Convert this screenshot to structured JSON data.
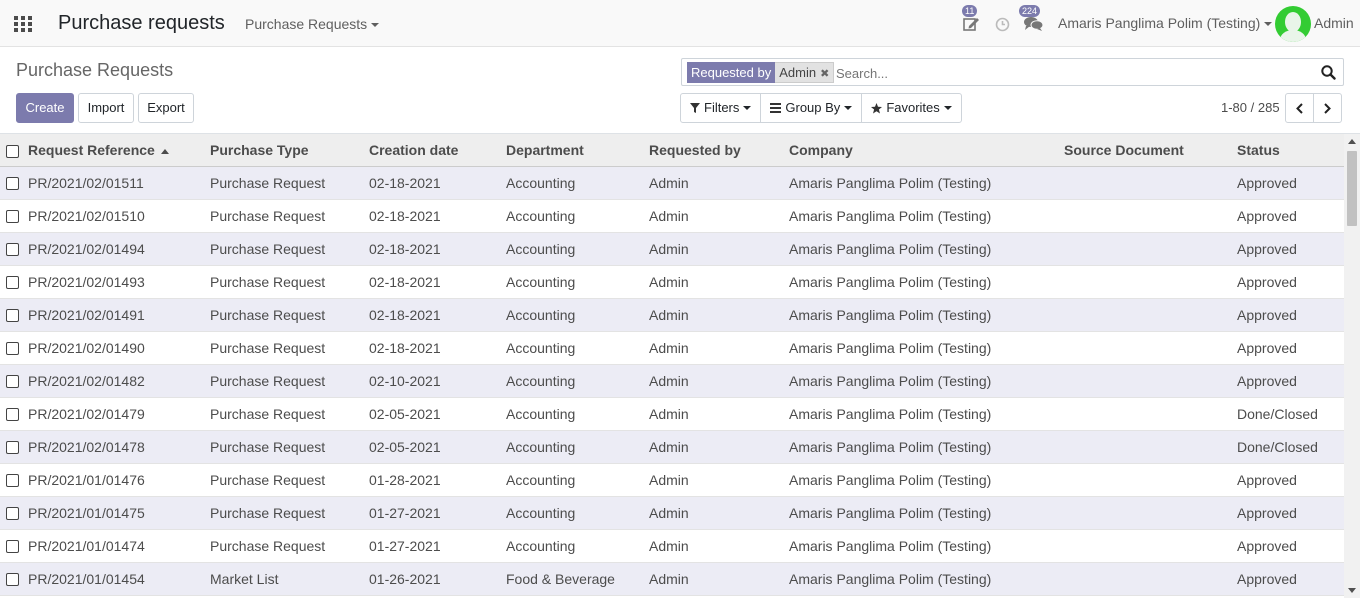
{
  "navbar": {
    "app_title": "Purchase requests",
    "menu": "Purchase Requests",
    "activity_count": "11",
    "messages_count": "224",
    "company": "Amaris Panglima Polim (Testing)",
    "user": "Admin"
  },
  "control_panel": {
    "breadcrumb": "Purchase Requests",
    "create_label": "Create",
    "import_label": "Import",
    "export_label": "Export",
    "search": {
      "facet_label": "Requested by",
      "facet_value": "Admin",
      "placeholder": "Search..."
    },
    "filters_label": "Filters",
    "groupby_label": "Group By",
    "favorites_label": "Favorites",
    "pager": "1-80 / 285"
  },
  "table": {
    "columns": [
      "Request Reference",
      "Purchase Type",
      "Creation date",
      "Department",
      "Requested by",
      "Company",
      "Source Document",
      "Status"
    ],
    "rows": [
      [
        "PR/2021/02/01511",
        "Purchase Request",
        "02-18-2021",
        "Accounting",
        "Admin",
        "Amaris Panglima Polim (Testing)",
        "",
        "Approved"
      ],
      [
        "PR/2021/02/01510",
        "Purchase Request",
        "02-18-2021",
        "Accounting",
        "Admin",
        "Amaris Panglima Polim (Testing)",
        "",
        "Approved"
      ],
      [
        "PR/2021/02/01494",
        "Purchase Request",
        "02-18-2021",
        "Accounting",
        "Admin",
        "Amaris Panglima Polim (Testing)",
        "",
        "Approved"
      ],
      [
        "PR/2021/02/01493",
        "Purchase Request",
        "02-18-2021",
        "Accounting",
        "Admin",
        "Amaris Panglima Polim (Testing)",
        "",
        "Approved"
      ],
      [
        "PR/2021/02/01491",
        "Purchase Request",
        "02-18-2021",
        "Accounting",
        "Admin",
        "Amaris Panglima Polim (Testing)",
        "",
        "Approved"
      ],
      [
        "PR/2021/02/01490",
        "Purchase Request",
        "02-18-2021",
        "Accounting",
        "Admin",
        "Amaris Panglima Polim (Testing)",
        "",
        "Approved"
      ],
      [
        "PR/2021/02/01482",
        "Purchase Request",
        "02-10-2021",
        "Accounting",
        "Admin",
        "Amaris Panglima Polim (Testing)",
        "",
        "Approved"
      ],
      [
        "PR/2021/02/01479",
        "Purchase Request",
        "02-05-2021",
        "Accounting",
        "Admin",
        "Amaris Panglima Polim (Testing)",
        "",
        "Done/Closed"
      ],
      [
        "PR/2021/02/01478",
        "Purchase Request",
        "02-05-2021",
        "Accounting",
        "Admin",
        "Amaris Panglima Polim (Testing)",
        "",
        "Done/Closed"
      ],
      [
        "PR/2021/01/01476",
        "Purchase Request",
        "01-28-2021",
        "Accounting",
        "Admin",
        "Amaris Panglima Polim (Testing)",
        "",
        "Approved"
      ],
      [
        "PR/2021/01/01475",
        "Purchase Request",
        "01-27-2021",
        "Accounting",
        "Admin",
        "Amaris Panglima Polim (Testing)",
        "",
        "Approved"
      ],
      [
        "PR/2021/01/01474",
        "Purchase Request",
        "01-27-2021",
        "Accounting",
        "Admin",
        "Amaris Panglima Polim (Testing)",
        "",
        "Approved"
      ],
      [
        "PR/2021/01/01454",
        "Market List",
        "01-26-2021",
        "Food & Beverage",
        "Admin",
        "Amaris Panglima Polim (Testing)",
        "",
        "Approved"
      ]
    ]
  },
  "colors": {
    "primary": "#7c7bad",
    "row_alt": "#ececf5",
    "header_bg": "#eeeeee"
  }
}
